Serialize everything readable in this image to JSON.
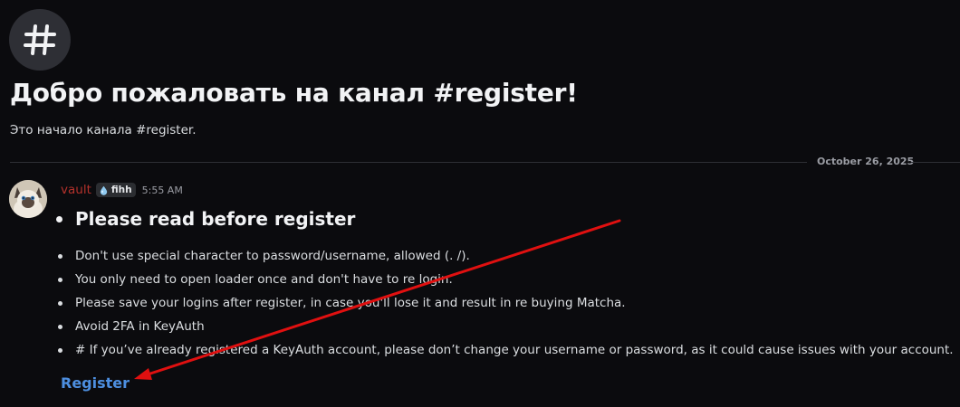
{
  "channel_intro": {
    "icon": "hash-icon",
    "title": "Добро пожаловать на канал #register!",
    "subtitle": "Это начало канала #register."
  },
  "divider": {
    "date": "October 26, 2025"
  },
  "message": {
    "author": {
      "name": "vault",
      "name_color": "#b3312b",
      "avatar": "cat-avatar",
      "tag": {
        "icon": "water-drop-icon",
        "label": "fihh"
      }
    },
    "timestamp": "5:55 AM",
    "heading": "Please read before register",
    "rules": [
      "Don't use special character to password/username, allowed (. /).",
      "You only need to open loader once and don't have to re login.",
      "Please save your logins after register, in case you'll lose it and result in re buying Matcha.",
      "Avoid 2FA in KeyAuth",
      "# If you’ve already registered a KeyAuth account, please don’t change your username or password, as it could cause issues with your account."
    ],
    "link": {
      "label": "Register",
      "color": "#4d8fe0"
    }
  },
  "annotation": {
    "type": "red-arrow",
    "color": "#e01010",
    "points_to": "register-link"
  }
}
